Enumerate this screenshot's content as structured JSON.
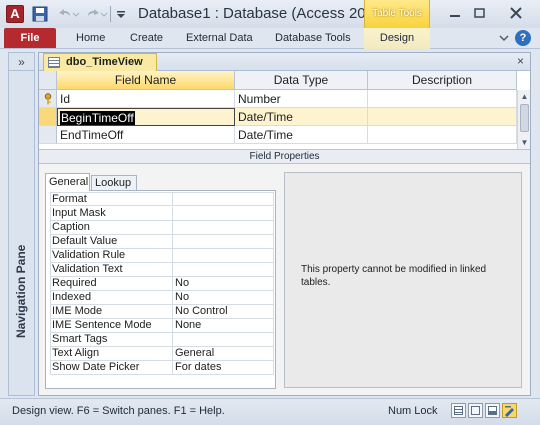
{
  "titlebar": {
    "app_icon": "A",
    "title": "Database1 : Database (Access 20...",
    "contextual_group": "Table Tools",
    "minimize_icon": "minimize-icon",
    "maximize_icon": "maximize-icon",
    "close_icon": "close-icon"
  },
  "ribbon": {
    "file_label": "File",
    "tabs": [
      {
        "label": "Home"
      },
      {
        "label": "Create"
      },
      {
        "label": "External Data"
      },
      {
        "label": "Database Tools"
      },
      {
        "label": "Design"
      }
    ]
  },
  "nav_pane": {
    "toggle": "»",
    "label": "Navigation Pane"
  },
  "document": {
    "tab_label": "dbo_TimeView",
    "close": "×",
    "columns": [
      "Field Name",
      "Data Type",
      "Description"
    ],
    "rows": [
      {
        "field": "Id",
        "type": "Number",
        "description": "",
        "primary_key": true
      },
      {
        "field": "BeginTimeOff",
        "type": "Date/Time",
        "description": "",
        "selected": true
      },
      {
        "field": "EndTimeOff",
        "type": "Date/Time",
        "description": ""
      }
    ],
    "field_properties_title": "Field Properties",
    "property_tabs": [
      "General",
      "Lookup"
    ],
    "properties": [
      {
        "name": "Format",
        "value": ""
      },
      {
        "name": "Input Mask",
        "value": ""
      },
      {
        "name": "Caption",
        "value": ""
      },
      {
        "name": "Default Value",
        "value": ""
      },
      {
        "name": "Validation Rule",
        "value": ""
      },
      {
        "name": "Validation Text",
        "value": ""
      },
      {
        "name": "Required",
        "value": "No"
      },
      {
        "name": "Indexed",
        "value": "No"
      },
      {
        "name": "IME Mode",
        "value": "No Control"
      },
      {
        "name": "IME Sentence Mode",
        "value": "None"
      },
      {
        "name": "Smart Tags",
        "value": ""
      },
      {
        "name": "Text Align",
        "value": "General"
      },
      {
        "name": "Show Date Picker",
        "value": "For dates"
      }
    ],
    "help_text": "This property cannot be modified in linked tables."
  },
  "statusbar": {
    "text": "Design view.  F6 = Switch panes.  F1 = Help.",
    "numlock": "Num Lock"
  },
  "colors": {
    "file_tab": "#b52a2f",
    "contextual": "#f8d23a",
    "header_selected": "#ffd86b"
  }
}
